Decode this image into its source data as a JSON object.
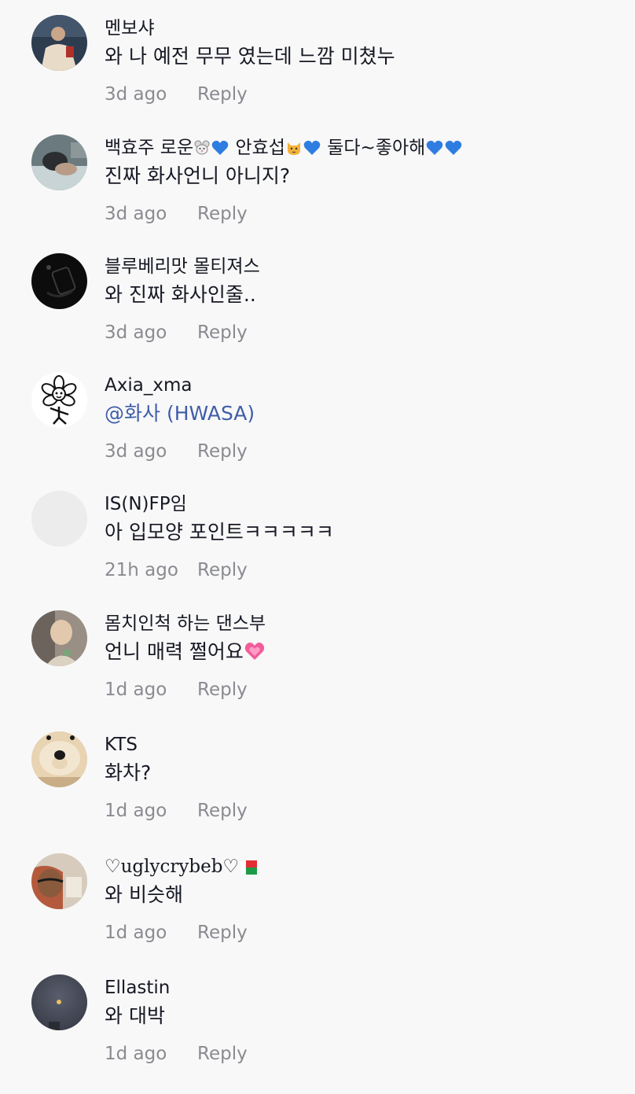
{
  "comments": [
    {
      "username": "멘보샤",
      "text": "와 나 예전 무무 였는데 느깜 미쳤누",
      "time": "3d ago",
      "reply": "Reply",
      "avatar_icon": "person-photo-avatar"
    },
    {
      "username_parts": [
        "백효주 로운",
        "안효섭",
        "둘다~좋아해"
      ],
      "emojis": [
        "mouse-face-icon",
        "blue-heart-icon",
        "cat-face-icon",
        "blue-heart-icon",
        "blue-heart-icon",
        "blue-heart-icon"
      ],
      "text": "진짜 화사언니 아니지?",
      "time": "3d ago",
      "reply": "Reply",
      "avatar_icon": "sleeping-person-photo-avatar"
    },
    {
      "username": "블루베리맛 몰티져스",
      "text": "와 진짜 화사인줄..",
      "time": "3d ago",
      "reply": "Reply",
      "avatar_icon": "dark-photo-avatar"
    },
    {
      "username": "Axia_xma",
      "text": "@화사 (HWASA)",
      "time": "3d ago",
      "reply": "Reply",
      "avatar_icon": "flower-character-avatar"
    },
    {
      "username": "IS(N)FP임",
      "text": "아 입모양 포인트ㅋㅋㅋㅋㅋ",
      "time": "21h ago",
      "reply": "Reply",
      "avatar_icon": "blank-avatar"
    },
    {
      "username": "몸치인척 하는 댄스부",
      "text": "언니 매력 쩔어요",
      "text_emoji": "growing-heart-icon",
      "time": "1d ago",
      "reply": "Reply",
      "avatar_icon": "person-photo-avatar"
    },
    {
      "username": "KTS",
      "text": "화차?",
      "time": "1d ago",
      "reply": "Reply",
      "avatar_icon": "dog-photo-avatar"
    },
    {
      "username": "♡uglycrybeb♡",
      "username_emoji": "flag-madagascar-icon",
      "text": "와 비슷해",
      "time": "1d ago",
      "reply": "Reply",
      "avatar_icon": "person-photo-avatar"
    },
    {
      "username": "Ellastin",
      "text": "와 대박",
      "time": "1d ago",
      "reply": "Reply",
      "avatar_icon": "moon-night-sky-avatar"
    }
  ],
  "colors": {
    "background": "#f8f8f8",
    "primary_text": "#161823",
    "secondary_text": "#8a8b91",
    "mention": "#3f5ea8"
  }
}
